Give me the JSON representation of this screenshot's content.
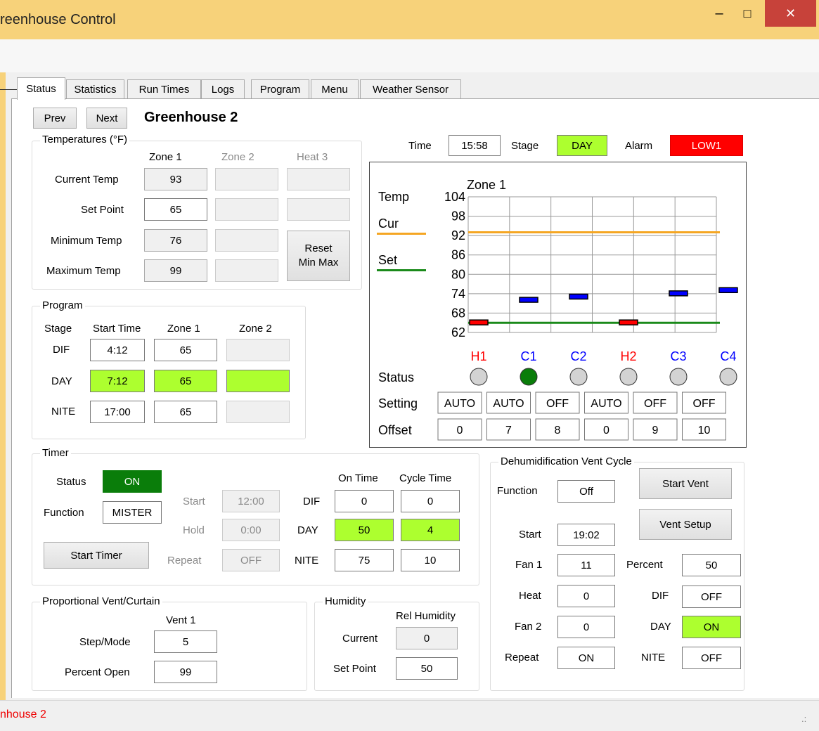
{
  "window": {
    "title": "Greenhouse Control",
    "title_visible": "reenhouse Control",
    "minimize": "–",
    "maximize": "□",
    "close": "✕"
  },
  "tabs": [
    "Status",
    "Statistics",
    "Run Times",
    "Logs",
    "Program",
    "Menu",
    "Weather Sensor"
  ],
  "nav": {
    "prev": "Prev",
    "next": "Next",
    "greenhouse": "Greenhouse 2"
  },
  "temps": {
    "title": "Temperatures (°F)",
    "cols": [
      "Zone 1",
      "Zone 2",
      "Heat 3"
    ],
    "rows": [
      {
        "label": "Current Temp",
        "z1": "93"
      },
      {
        "label": "Set Point",
        "z1": "65"
      },
      {
        "label": "Minimum Temp",
        "z1": "76"
      },
      {
        "label": "Maximum Temp",
        "z1": "99"
      }
    ],
    "reset": "Reset\nMin Max"
  },
  "program": {
    "title": "Program",
    "cols": [
      "Stage",
      "Start Time",
      "Zone 1",
      "Zone 2"
    ],
    "rows": [
      {
        "stage": "DIF",
        "start": "4:12",
        "z1": "65"
      },
      {
        "stage": "DAY",
        "start": "7:12",
        "z1": "65"
      },
      {
        "stage": "NITE",
        "start": "17:00",
        "z1": "65"
      }
    ]
  },
  "timer": {
    "title": "Timer",
    "status_label": "Status",
    "status": "ON",
    "function_label": "Function",
    "function": "MISTER",
    "start_label": "Start",
    "start": "12:00",
    "hold_label": "Hold",
    "hold": "0:00",
    "repeat_label": "Repeat",
    "repeat": "OFF",
    "start_button": "Start Timer",
    "on_time": "On Time",
    "cycle_time": "Cycle Time",
    "rows": [
      {
        "stage": "DIF",
        "on": "0",
        "cycle": "0"
      },
      {
        "stage": "DAY",
        "on": "50",
        "cycle": "4"
      },
      {
        "stage": "NITE",
        "on": "75",
        "cycle": "10"
      }
    ]
  },
  "prop": {
    "title": "Proportional Vent/Curtain",
    "col": "Vent 1",
    "step_label": "Step/Mode",
    "step": "5",
    "pct_label": "Percent Open",
    "pct": "99"
  },
  "humidity": {
    "title": "Humidity",
    "col": "Rel Humidity",
    "current_label": "Current",
    "current": "0",
    "set_label": "Set Point",
    "set": "50"
  },
  "dehum": {
    "title": "Dehumidification Vent Cycle",
    "function_label": "Function",
    "function": "Off",
    "start_vent": "Start Vent",
    "vent_setup": "Vent Setup",
    "start_label": "Start",
    "start": "19:02",
    "fan1_label": "Fan 1",
    "fan1": "11",
    "heat_label": "Heat",
    "heat": "0",
    "fan2_label": "Fan 2",
    "fan2": "0",
    "repeat_label": "Repeat",
    "repeat": "ON",
    "percent_label": "Percent",
    "percent": "50",
    "dif_label": "DIF",
    "dif": "OFF",
    "day_label": "DAY",
    "day": "ON",
    "nite_label": "NITE",
    "nite": "OFF"
  },
  "header": {
    "time_label": "Time",
    "time": "15:58",
    "stage_label": "Stage",
    "stage": "DAY",
    "alarm_label": "Alarm",
    "alarm": "LOW1"
  },
  "chart_data": {
    "type": "line",
    "title": "Zone 1",
    "ylabel": "Temp",
    "y_ticks": [
      104,
      98,
      92,
      86,
      80,
      74,
      68,
      62
    ],
    "ylim": [
      62,
      104
    ],
    "legend": [
      {
        "name": "Cur",
        "color": "#f5a623",
        "value": 93
      },
      {
        "name": "Set",
        "color": "#1a8a1a",
        "value": 65
      }
    ],
    "outputs": [
      {
        "name": "H1",
        "color": "#ff0000",
        "value": 65,
        "status": "off",
        "setting": "AUTO",
        "offset": "0"
      },
      {
        "name": "C1",
        "color": "#0000ff",
        "value": 72,
        "status": "on",
        "setting": "AUTO",
        "offset": "7"
      },
      {
        "name": "C2",
        "color": "#0000ff",
        "value": 73,
        "status": "off",
        "setting": "OFF",
        "offset": "8"
      },
      {
        "name": "H2",
        "color": "#ff0000",
        "value": 65,
        "status": "off",
        "setting": "AUTO",
        "offset": "0"
      },
      {
        "name": "C3",
        "color": "#0000ff",
        "value": 74,
        "status": "off",
        "setting": "OFF",
        "offset": "9"
      },
      {
        "name": "C4",
        "color": "#0000ff",
        "value": 75,
        "status": "off",
        "setting": "OFF",
        "offset": "10"
      }
    ],
    "row_labels": {
      "status": "Status",
      "setting": "Setting",
      "offset": "Offset"
    }
  },
  "statusbar": {
    "text": "nhouse 2",
    "grip": ".:"
  }
}
